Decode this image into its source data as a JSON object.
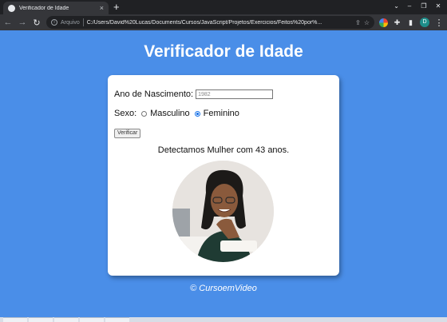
{
  "browser": {
    "tab_title": "Verificador de Idade",
    "tab_close": "×",
    "new_tab": "+",
    "address_label": "Arquivo",
    "url": "C:/Users/David%20Lucas/Documents/Cursos/JavaScript/Projetos/Exercicios/Feitos%20por%...",
    "profile_initial": "D"
  },
  "page": {
    "title": "Verificador de Idade",
    "year_label": "Ano de Nascimento:",
    "year_value": "1982",
    "sex_label": "Sexo:",
    "option_male": "Masculino",
    "option_female": "Feminino",
    "selected_option": "Feminino",
    "button_label": "Verificar",
    "result_text": "Detectamos Mulher com 43 anos.",
    "footer": "© CursoemVideo"
  }
}
